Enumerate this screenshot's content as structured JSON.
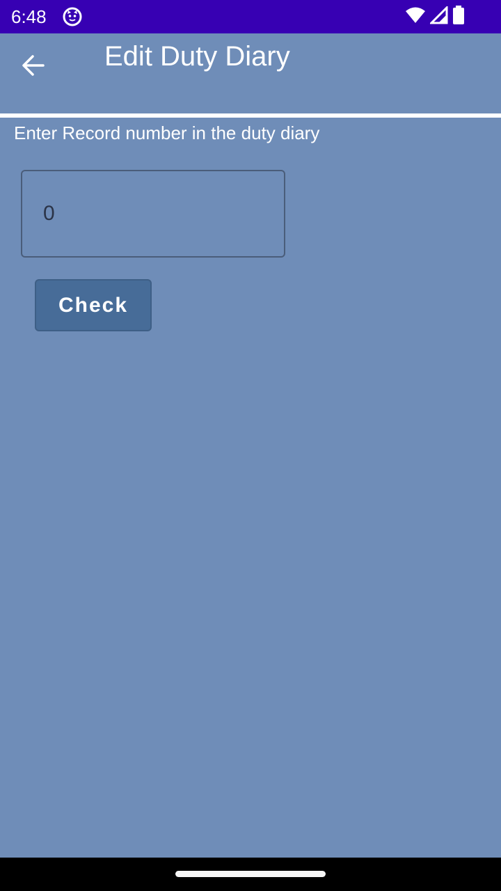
{
  "status_bar": {
    "time": "6:48",
    "icons": [
      "cat-notification-icon",
      "wifi-icon",
      "cellular-signal-icon",
      "battery-icon"
    ],
    "background": "#3700b3"
  },
  "app_bar": {
    "title": "Edit Duty Diary",
    "back_icon": "arrow-back-icon",
    "background": "#6f8db8"
  },
  "form": {
    "prompt": "Enter Record number in the duty diary",
    "record_input_value": "0",
    "check_button_label": "Check"
  },
  "colors": {
    "page_background": "#6f8db8",
    "button_background": "#476c98",
    "divider": "#ffffff"
  }
}
